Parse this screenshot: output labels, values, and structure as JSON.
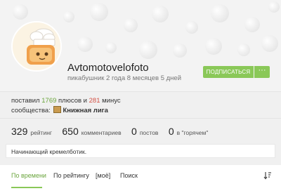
{
  "profile": {
    "username": "Avtomotovelofoto",
    "tenure": "пикабушник 2 года 8 месяцев 5 дней"
  },
  "actions": {
    "subscribe_label": "ПОДПИСАТЬСЯ",
    "more_label": "···"
  },
  "votes": {
    "prefix": "поставил",
    "plus": "1769",
    "plus_label": "плюсов и",
    "minus": "281",
    "minus_label": "минус"
  },
  "communities": {
    "label": "сообщества:",
    "items": [
      {
        "name": "Книжная лига",
        "icon": "book-community-icon"
      }
    ]
  },
  "metrics": [
    {
      "value": "329",
      "label": "рейтинг"
    },
    {
      "value": "650",
      "label": "комментариев"
    },
    {
      "value": "0",
      "label": "постов"
    },
    {
      "value": "0",
      "label": "в \"горячем\""
    }
  ],
  "bio": "Начинающий кремелботик.",
  "tabs": [
    {
      "label": "По времени",
      "active": true
    },
    {
      "label": "По рейтингу",
      "active": false
    },
    {
      "label": "[моё]",
      "active": false
    },
    {
      "label": "Поиск",
      "active": false
    }
  ],
  "colors": {
    "accent": "#8ac858",
    "plus": "#6aa53c",
    "minus": "#d34f43"
  }
}
